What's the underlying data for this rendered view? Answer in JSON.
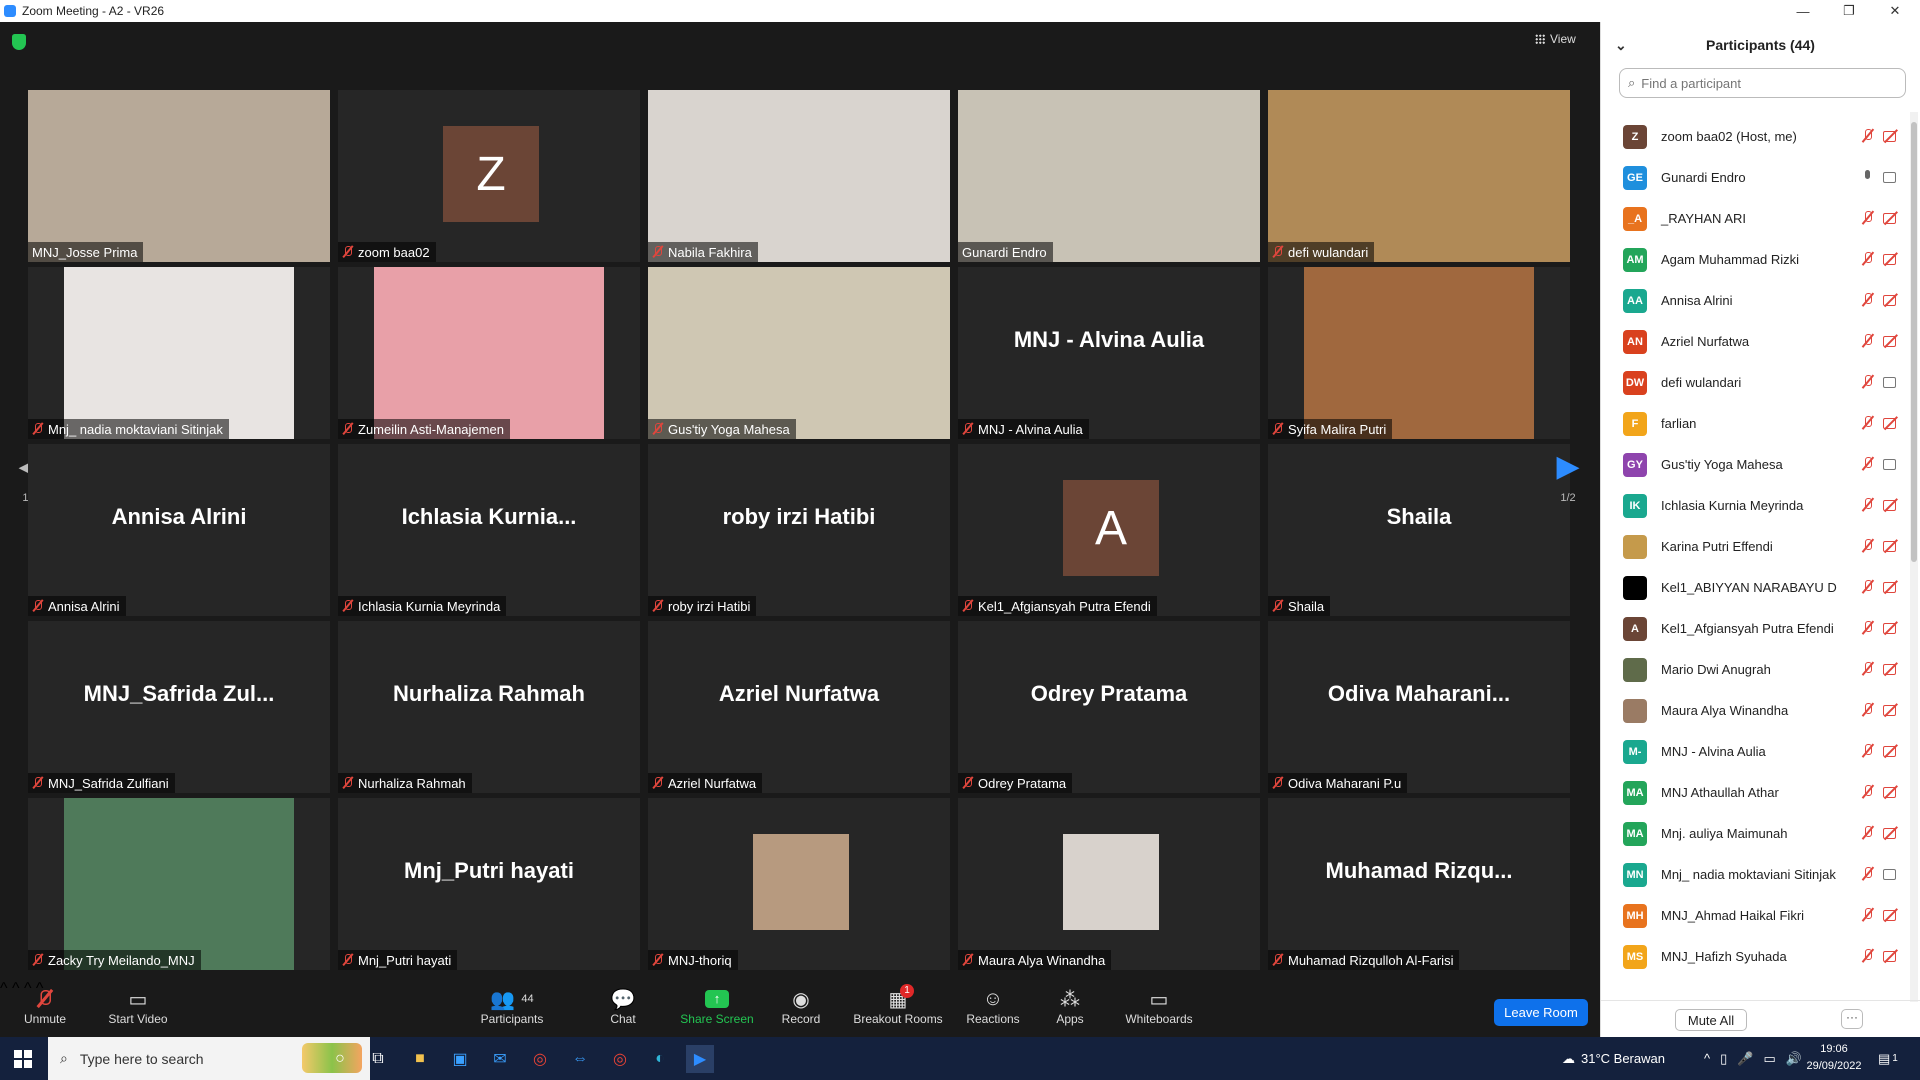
{
  "window": {
    "title": "Zoom Meeting - A2 - VR26"
  },
  "top": {
    "view_label": "View"
  },
  "tiles": [
    {
      "label": "MNJ_Josse Prima",
      "kind": "video",
      "muted": false,
      "bg": "#b7a998"
    },
    {
      "label": "zoom baa02",
      "kind": "avatar",
      "avatar": "Z",
      "muted": true
    },
    {
      "label": "Nabila Fakhira",
      "kind": "video",
      "muted": true,
      "bg": "#d9d4cf"
    },
    {
      "label": "Gunardi Endro",
      "kind": "video",
      "muted": false,
      "bg": "#c8c2b5",
      "speaking": true
    },
    {
      "label": "defi wulandari",
      "kind": "video",
      "muted": true,
      "bg": "#b08a57"
    },
    {
      "label": "Mnj_ nadia moktaviani Sitinjak",
      "kind": "video",
      "muted": true,
      "bg": "#e8e4e2",
      "narrow": true
    },
    {
      "label": "Zumeilin Asti-Manajemen",
      "kind": "video",
      "muted": true,
      "bg": "#e8a0a8",
      "narrow": true
    },
    {
      "label": "Gus'tiy Yoga Mahesa",
      "kind": "video",
      "muted": true,
      "bg": "#cfc7b3"
    },
    {
      "label": "MNJ - Alvina Aulia",
      "kind": "name",
      "big": "MNJ - Alvina Aulia",
      "muted": true
    },
    {
      "label": "Syifa Malira Putri",
      "kind": "video",
      "muted": true,
      "bg": "#a0683e",
      "narrow": true
    },
    {
      "label": "Annisa Alrini",
      "kind": "name",
      "big": "Annisa Alrini",
      "muted": true
    },
    {
      "label": "Ichlasia Kurnia Meyrinda",
      "kind": "name",
      "big": "Ichlasia  Kurnia...",
      "muted": true
    },
    {
      "label": "roby irzi Hatibi",
      "kind": "name",
      "big": "roby irzi Hatibi",
      "muted": true
    },
    {
      "label": "Kel1_Afgiansyah Putra Efendi",
      "kind": "avatar",
      "avatar": "A",
      "muted": true
    },
    {
      "label": "Shaila",
      "kind": "name",
      "big": "Shaila",
      "muted": true
    },
    {
      "label": "MNJ_Safrida Zulfiani",
      "kind": "name",
      "big": "MNJ_Safrida  Zul...",
      "muted": true
    },
    {
      "label": "Nurhaliza Rahmah",
      "kind": "name",
      "big": "Nurhaliza Rahmah",
      "muted": true
    },
    {
      "label": "Azriel Nurfatwa",
      "kind": "name",
      "big": "Azriel Nurfatwa",
      "muted": true
    },
    {
      "label": "Odrey Pratama",
      "kind": "name",
      "big": "Odrey Pratama",
      "muted": true
    },
    {
      "label": "Odiva Maharani P.u",
      "kind": "name",
      "big": "Odiva  Maharani...",
      "muted": true
    },
    {
      "label": "Zacky Try Meilando_MNJ",
      "kind": "video",
      "muted": true,
      "bg": "#4f7a5a",
      "narrow": true
    },
    {
      "label": "Mnj_Putri hayati",
      "kind": "name",
      "big": "Mnj_Putri hayati",
      "muted": true
    },
    {
      "label": "MNJ-thoriq",
      "kind": "photo",
      "muted": true,
      "bg": "#b79a7f"
    },
    {
      "label": "Maura Alya Winandha",
      "kind": "photo",
      "muted": true,
      "bg": "#d8d2cc"
    },
    {
      "label": "Muhamad Rizqulloh Al-Farisi",
      "kind": "name",
      "big": "Muhamad  Rizqu...",
      "muted": true
    }
  ],
  "pager": {
    "left": "1/2",
    "right": "1/2"
  },
  "toolbar": {
    "unmute": "Unmute",
    "start_video": "Start Video",
    "participants": "Participants",
    "participants_count": "44",
    "chat": "Chat",
    "share_screen": "Share Screen",
    "record": "Record",
    "breakout_rooms": "Breakout Rooms",
    "breakout_badge": "1",
    "reactions": "Reactions",
    "apps": "Apps",
    "whiteboards": "Whiteboards",
    "leave_room": "Leave Room"
  },
  "panel": {
    "title": "Participants (44)",
    "search_placeholder": "Find a participant",
    "mute_all": "Mute All",
    "more": "···",
    "participants": [
      {
        "initials": "Z",
        "name": "zoom baa02 (Host, me)",
        "color": "#6b4536",
        "mic": "off",
        "cam": "off"
      },
      {
        "initials": "GE",
        "name": "Gunardi Endro",
        "color": "#1f8fdd",
        "mic": "on",
        "cam": "on"
      },
      {
        "initials": "_A",
        "name": "_RAYHAN ARI",
        "color": "#e8731e",
        "mic": "off",
        "cam": "off"
      },
      {
        "initials": "AM",
        "name": "Agam Muhammad Rizki",
        "color": "#23a55a",
        "mic": "off",
        "cam": "off"
      },
      {
        "initials": "AA",
        "name": "Annisa Alrini",
        "color": "#1aa88f",
        "mic": "off",
        "cam": "off"
      },
      {
        "initials": "AN",
        "name": "Azriel Nurfatwa",
        "color": "#d9411e",
        "mic": "off",
        "cam": "off"
      },
      {
        "initials": "DW",
        "name": "defi wulandari",
        "color": "#d9411e",
        "mic": "off",
        "cam": "on"
      },
      {
        "initials": "F",
        "name": "farlian",
        "color": "#f2a51a",
        "mic": "off",
        "cam": "off"
      },
      {
        "initials": "GY",
        "name": "Gus'tiy Yoga Mahesa",
        "color": "#8e44ad",
        "mic": "off",
        "cam": "on"
      },
      {
        "initials": "IK",
        "name": "Ichlasia Kurnia Meyrinda",
        "color": "#1aa88f",
        "mic": "off",
        "cam": "off"
      },
      {
        "initials": "",
        "name": "Karina Putri Effendi",
        "color": "#c59a4b",
        "mic": "off",
        "cam": "off"
      },
      {
        "initials": "",
        "name": "Kel1_ABIYYAN NARABAYU D",
        "color": "#000000",
        "mic": "off",
        "cam": "off"
      },
      {
        "initials": "A",
        "name": "Kel1_Afgiansyah Putra Efendi",
        "color": "#6b4536",
        "mic": "off",
        "cam": "off"
      },
      {
        "initials": "",
        "name": "Mario Dwi Anugrah",
        "color": "#5f6b4a",
        "mic": "off",
        "cam": "off"
      },
      {
        "initials": "",
        "name": "Maura Alya Winandha",
        "color": "#9a7b64",
        "mic": "off",
        "cam": "off"
      },
      {
        "initials": "M-",
        "name": "MNJ - Alvina Aulia",
        "color": "#1aa88f",
        "mic": "off",
        "cam": "off"
      },
      {
        "initials": "MA",
        "name": "MNJ Athaullah Athar",
        "color": "#23a55a",
        "mic": "off",
        "cam": "off"
      },
      {
        "initials": "MA",
        "name": "Mnj. auliya Maimunah",
        "color": "#23a55a",
        "mic": "off",
        "cam": "off"
      },
      {
        "initials": "MN",
        "name": "Mnj_ nadia moktaviani Sitinjak",
        "color": "#1aa88f",
        "mic": "off",
        "cam": "on"
      },
      {
        "initials": "MH",
        "name": "MNJ_Ahmad Haikal Fikri",
        "color": "#e8731e",
        "mic": "off",
        "cam": "off"
      },
      {
        "initials": "MS",
        "name": "MNJ_Hafizh Syuhada",
        "color": "#f2a51a",
        "mic": "off",
        "cam": "off"
      }
    ]
  },
  "taskbar": {
    "search_placeholder": "Type here to search",
    "weather": "31°C  Berawan",
    "time": "19:06",
    "date": "29/09/2022",
    "notif_count": "1"
  }
}
